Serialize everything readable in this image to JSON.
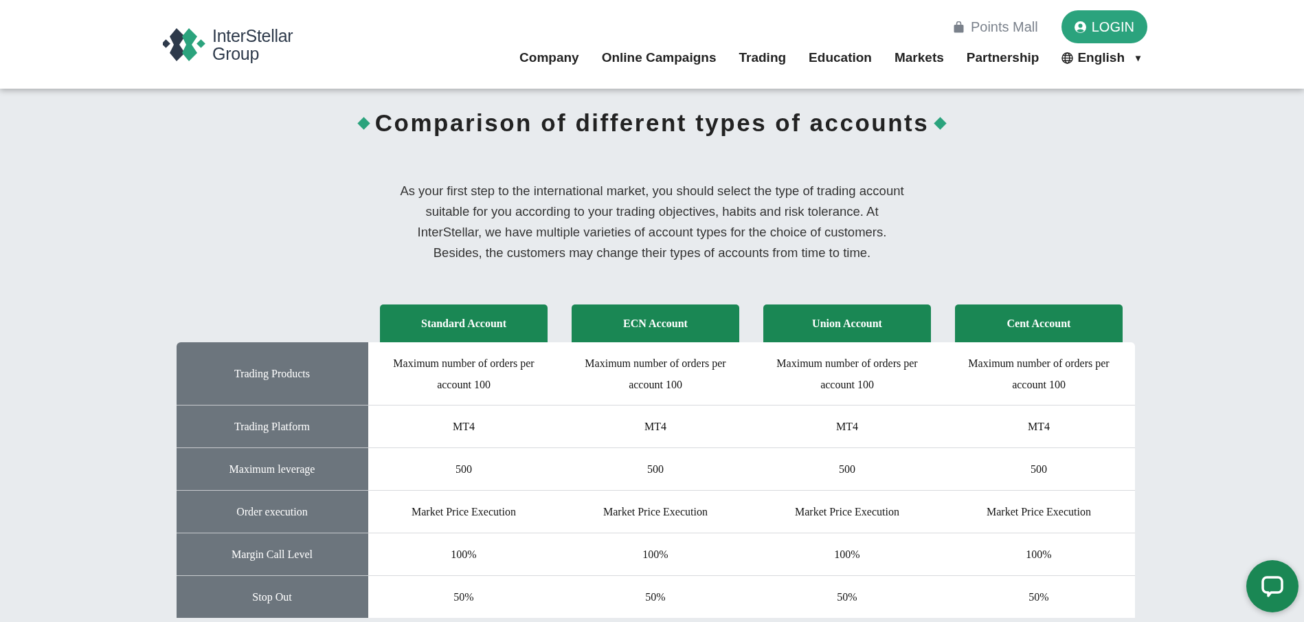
{
  "header": {
    "logo": {
      "line1": "InterStellar",
      "line2": "Group"
    },
    "points_mall": "Points Mall",
    "login": "LOGIN",
    "nav": [
      {
        "label": "Company"
      },
      {
        "label": "Online Campaigns"
      },
      {
        "label": "Trading"
      },
      {
        "label": "Education"
      },
      {
        "label": "Markets"
      },
      {
        "label": "Partnership"
      }
    ],
    "language": {
      "label": "English",
      "caret": "▾"
    }
  },
  "title": "Comparison of different types of accounts",
  "intro": "As your first step to the international market, you should select the type of trading account suitable for you according to your trading objectives, habits and risk tolerance. At InterStellar, we have multiple varieties of account types for the choice of customers. Besides, the customers may change their types of accounts from time to time.",
  "table": {
    "columns": [
      "Standard Account",
      "ECN Account",
      "Union Account",
      "Cent Account"
    ],
    "rows": [
      {
        "label": "Trading Products",
        "values": [
          "Maximum number of orders per account 100",
          "Maximum number of orders per account 100",
          "Maximum number of orders per account 100",
          "Maximum number of orders per account 100"
        ]
      },
      {
        "label": "Trading Platform",
        "values": [
          "MT4",
          "MT4",
          "MT4",
          "MT4"
        ]
      },
      {
        "label": "Maximum leverage",
        "values": [
          "500",
          "500",
          "500",
          "500"
        ]
      },
      {
        "label": "Order execution",
        "values": [
          "Market Price Execution",
          "Market Price Execution",
          "Market Price Execution",
          "Market Price Execution"
        ]
      },
      {
        "label": "Margin Call Level",
        "values": [
          "100%",
          "100%",
          "100%",
          "100%"
        ]
      },
      {
        "label": "Stop Out",
        "values": [
          "50%",
          "50%",
          "50%",
          "50%"
        ]
      }
    ]
  }
}
